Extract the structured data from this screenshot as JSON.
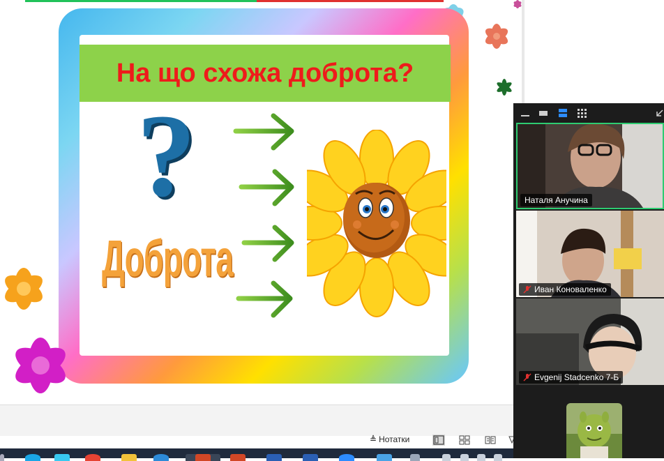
{
  "slide": {
    "title": "На що схожа доброта?",
    "question_mark": "?",
    "word": "Доброта",
    "arrow_glyph": "→"
  },
  "participants": [
    {
      "name": "Наталя Анучина",
      "muted": false,
      "active_speaker": true
    },
    {
      "name": "Иван Коноваленко",
      "muted": true,
      "active_speaker": false
    },
    {
      "name": "Evgenij Stadcenko 7-Б",
      "muted": true,
      "active_speaker": false
    },
    {
      "name": "",
      "muted": false,
      "active_speaker": false
    }
  ],
  "status_bar": {
    "notes_label": "Нотатки"
  },
  "colors": {
    "title_text": "#ee1b1b",
    "title_band": "#8dd24a",
    "active_speaker_border": "#2ecc71",
    "mute_icon": "#e0312f"
  },
  "icons": {
    "panel_toolbar": [
      "minimize-icon",
      "speaker-view-icon",
      "strip-view-icon",
      "gallery-grid-icon",
      "collapse-arrow-icon"
    ],
    "status_bar": [
      "notes-icon",
      "normal-view-icon",
      "slide-sorter-icon",
      "reading-view-icon"
    ]
  }
}
